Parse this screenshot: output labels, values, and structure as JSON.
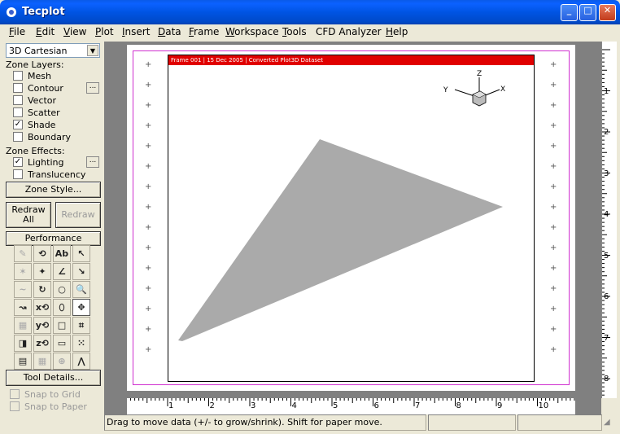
{
  "window": {
    "title": "Tecplot",
    "minimize": "_",
    "maximize": "□",
    "close": "✕"
  },
  "menu": [
    {
      "u": "F",
      "rest": "ile"
    },
    {
      "u": "E",
      "rest": "dit"
    },
    {
      "u": "V",
      "rest": "iew"
    },
    {
      "u": "P",
      "rest": "lot"
    },
    {
      "u": "I",
      "rest": "nsert"
    },
    {
      "u": "D",
      "rest": "ata"
    },
    {
      "u": "F",
      "rest": "rame"
    },
    {
      "u": "W",
      "rest": "orkspace"
    },
    {
      "u": "T",
      "rest": "ools"
    },
    {
      "u": "",
      "rest": "CFD Analyzer"
    },
    {
      "u": "H",
      "rest": "elp"
    }
  ],
  "sidebar": {
    "plot_type": "3D Cartesian",
    "zone_layers_label": "Zone Layers:",
    "layers": [
      {
        "label": "Mesh",
        "checked": false
      },
      {
        "label": "Contour",
        "checked": false,
        "dots": true
      },
      {
        "label": "Vector",
        "checked": false
      },
      {
        "label": "Scatter",
        "checked": false
      },
      {
        "label": "Shade",
        "checked": true
      },
      {
        "label": "Boundary",
        "checked": false
      }
    ],
    "zone_effects_label": "Zone Effects:",
    "effects": [
      {
        "label": "Lighting",
        "checked": true,
        "dots": true
      },
      {
        "label": "Translucency",
        "checked": false
      }
    ],
    "zone_style_label": "Zone Style...",
    "redraw_all_label": "Redraw\nAll",
    "redraw_label": "Redraw",
    "performance_label": "Performance",
    "tool_details_label": "Tool Details...",
    "snap_grid_label": "Snap to Grid",
    "snap_paper_label": "Snap to Paper",
    "dots_label": "..."
  },
  "tools": [
    {
      "name": "zone-edit-tool",
      "glyph": "✎",
      "dis": true
    },
    {
      "name": "rotate-tool",
      "glyph": "⟲"
    },
    {
      "name": "text-tool",
      "glyph": "Ab"
    },
    {
      "name": "select-tool",
      "glyph": "↖"
    },
    {
      "name": "probe-tool",
      "glyph": "✶",
      "dis": true
    },
    {
      "name": "streamtrace-tool",
      "glyph": "✦"
    },
    {
      "name": "line-tool",
      "glyph": "∠"
    },
    {
      "name": "adjust-tool",
      "glyph": "↘"
    },
    {
      "name": "polyline-tool",
      "glyph": "~",
      "dis": true
    },
    {
      "name": "spin-tool",
      "glyph": "↻"
    },
    {
      "name": "circle-tool",
      "glyph": "○"
    },
    {
      "name": "zoom-tool",
      "glyph": "🔍"
    },
    {
      "name": "slice-tool",
      "glyph": "↝"
    },
    {
      "name": "x-rotate-tool",
      "glyph": "x⟲"
    },
    {
      "name": "ellipse-tool",
      "glyph": "⬯"
    },
    {
      "name": "translate-tool",
      "glyph": "✥",
      "active": true
    },
    {
      "name": "geometry-tool",
      "glyph": "▦",
      "dis": true
    },
    {
      "name": "y-rotate-tool",
      "glyph": "y⟲"
    },
    {
      "name": "square-tool",
      "glyph": "□"
    },
    {
      "name": "grid-tool",
      "glyph": "⌗"
    },
    {
      "name": "extract-tool",
      "glyph": "◨"
    },
    {
      "name": "z-rotate-tool",
      "glyph": "z⟲"
    },
    {
      "name": "rectangle-tool",
      "glyph": "▭"
    },
    {
      "name": "scatter-tool",
      "glyph": "⁙"
    },
    {
      "name": "frame-tool",
      "glyph": "▤"
    },
    {
      "name": "table-tool",
      "glyph": "▦",
      "dis": true
    },
    {
      "name": "sphere-tool",
      "glyph": "⊕",
      "dis": true
    },
    {
      "name": "xy-line-tool",
      "glyph": "⋀"
    }
  ],
  "frame": {
    "header": "Frame 001  |  15 Dec 2005  |  Converted Plot3D Dataset",
    "axis_x": "X",
    "axis_y": "Y",
    "axis_z": "Z",
    "shape_color": "#aaaaaa",
    "header_color": "#e00000"
  },
  "rulers": {
    "h": [
      "1",
      "2",
      "3",
      "4",
      "5",
      "6",
      "7",
      "8",
      "9",
      "10"
    ],
    "v": [
      "1",
      "2",
      "3",
      "4",
      "5",
      "6",
      "7",
      "8"
    ]
  },
  "status": {
    "message": "Drag to move data (+/- to grow/shrink).  Shift for paper move.",
    "pane2": "",
    "pane3": ""
  }
}
